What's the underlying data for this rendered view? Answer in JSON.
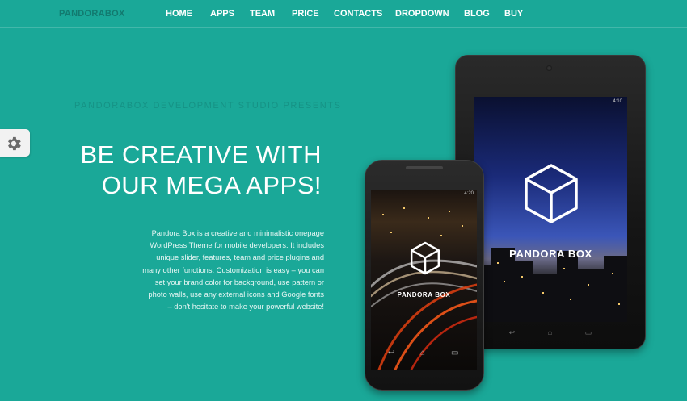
{
  "brand": "PANDORABOX",
  "nav": [
    "HOME",
    "APPS",
    "TEAM",
    "PRICE",
    "CONTACTS",
    "DROPDOWN",
    "BLOG",
    "BUY"
  ],
  "settings": {
    "icon": "gear-icon"
  },
  "hero": {
    "presents": "PANDORABOX DEVELOPMENT STUDIO PRESENTS",
    "headline": [
      "BE CREATIVE WITH",
      "OUR MEGA APPS!"
    ],
    "description": "Pandora Box is a creative and minimalistic onepage WordPress Theme for mobile developers. It includes unique slider, features, team and price plugins and many other functions. Customization is easy – you can set your brand color for background, use pattern or photo walls, use any external icons and Google fonts – don't hesitate to make your powerful website!"
  },
  "tablet": {
    "label": "PANDORA BOX",
    "status_time": "4:10"
  },
  "phone": {
    "label": "PANDORA BOX",
    "status_time": "4:20"
  },
  "colors": {
    "background": "#1aa898",
    "brand": "#127a6f",
    "subtitle": "#169285"
  }
}
